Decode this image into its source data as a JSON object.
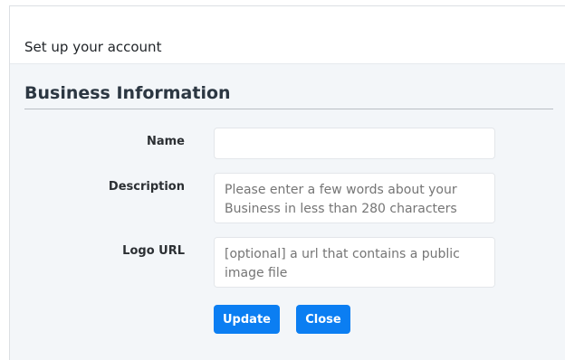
{
  "modal": {
    "title": "Set up your account"
  },
  "section": {
    "title": "Business Information"
  },
  "fields": {
    "name": {
      "label": "Name",
      "value": "",
      "placeholder": ""
    },
    "description": {
      "label": "Description",
      "value": "",
      "placeholder": "Please enter a few words about your Business in less than 280 characters"
    },
    "logo_url": {
      "label": "Logo URL",
      "value": "",
      "placeholder": "[optional] a url that contains a public image file"
    }
  },
  "buttons": {
    "update_label": "Update",
    "close_label": "Close"
  },
  "colors": {
    "primary": "#0b7ef2",
    "panel_background": "#f3f6f9"
  }
}
